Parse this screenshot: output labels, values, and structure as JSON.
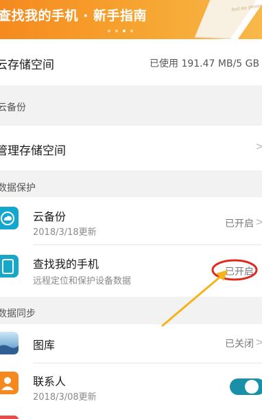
{
  "banner": {
    "title": "查找我的手机 · 新手指南",
    "book_text": "find my phone"
  },
  "storage": {
    "label": "云存储空间",
    "usage": "已使用 191.47 MB/5 GB"
  },
  "backup_header": "云备份",
  "manage_storage": {
    "label": "管理存储空间"
  },
  "data_protection": {
    "header": "数据保护",
    "items": [
      {
        "title": "云备份",
        "subtitle": "2018/3/18更新",
        "status": "已开启"
      },
      {
        "title": "查找我的手机",
        "subtitle": "远程定位和保护设备数据",
        "status": "已开启"
      }
    ]
  },
  "data_sync": {
    "header": "数据同步",
    "items": [
      {
        "title": "图库",
        "status": "已关闭"
      },
      {
        "title": "联系人",
        "subtitle": "2018/3/08更新",
        "toggle_on": true
      }
    ]
  },
  "annotation": {
    "color": "#e0281f",
    "arrow_color": "#f5b31a"
  }
}
